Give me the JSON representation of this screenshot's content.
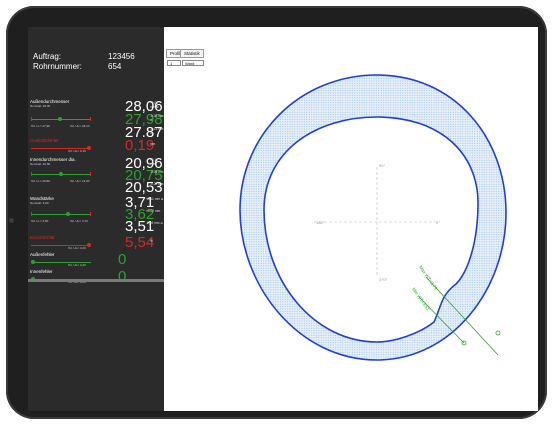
{
  "header": {
    "order_label": "Auftrag:",
    "order_value": "123456",
    "pipe_label": "Rohrnummer:",
    "pipe_value": "654"
  },
  "outer_diameter": {
    "title": "Außendurchmesser",
    "nominal": "Nominal: 28,00",
    "max": "28,06",
    "avg": "27,98",
    "min": "27,87",
    "unit_max": "+0,06 mm ⊕",
    "unit_avg": "-0,02 mm ⊘",
    "unit_min": "-0,13 mm ⊖",
    "tol_low": "Tol. LL= 27,90",
    "tol_high": "Tol. UL= 28,10",
    "max_color": "#ffffff",
    "avg_color": "#2ca02c",
    "min_color": "#ffffff"
  },
  "ovality": {
    "title": "Ovalitätsfehler",
    "value": "0,19",
    "unit": "mm",
    "tol": "Tol. UL= 0,15",
    "color": "#d62728"
  },
  "inner_diameter": {
    "title": "Innendurchmesser dia.",
    "nominal": "Nominal: 20,80",
    "max": "20,96",
    "avg": "20,75",
    "min": "20,53",
    "unit_max": "+0,16 mm",
    "unit_avg": "-0,05 mm",
    "unit_min": "-0,27 mm",
    "tol_low": "Tol. LL= 20,60",
    "tol_high": "Tol. UL= 21,00",
    "avg_color": "#2ca02c"
  },
  "wall_thickness": {
    "title": "Wandstärke",
    "nominal": "Nominal: 3,60",
    "max": "3,71",
    "avg": "3,62",
    "min": "3,51",
    "unit_max": "+0,11 mm ⊕",
    "unit_avg": "+0,02 mm",
    "unit_min": "-0,09 mm ⊖",
    "tol_low": "Tol. LL= 3,50",
    "tol_high": "Tol. UL= 3,70",
    "avg_color": "#2ca02c"
  },
  "eccentricity": {
    "title": "Exzentrizität",
    "value": "5,54",
    "unit": "%",
    "tol": "Tol. UL= 3,20",
    "color": "#d62728"
  },
  "outer_defects": {
    "title": "Außenfehler",
    "value": "0",
    "tol": "Tol. UL= 3,20",
    "color": "#2ca02c"
  },
  "inner_defects": {
    "title": "Innenfehler",
    "value": "0",
    "tol": "Tol. UL= 3,20",
    "color": "#2ca02c"
  },
  "tabs": [
    "Profil",
    "Statistik"
  ],
  "selects": {
    "first": "1",
    "second": "Ward"
  },
  "plot": {
    "angle_top": "90°",
    "angle_left": "180°",
    "angle_right": "0°",
    "angle_bottom": "270°",
    "annotation_max": "Max WT=3,71",
    "annotation_min": "Min WT=3,51",
    "ring_color": "#1f3fd6",
    "fill_color": "#cfe3f5",
    "annotation_color": "#2ca02c"
  }
}
